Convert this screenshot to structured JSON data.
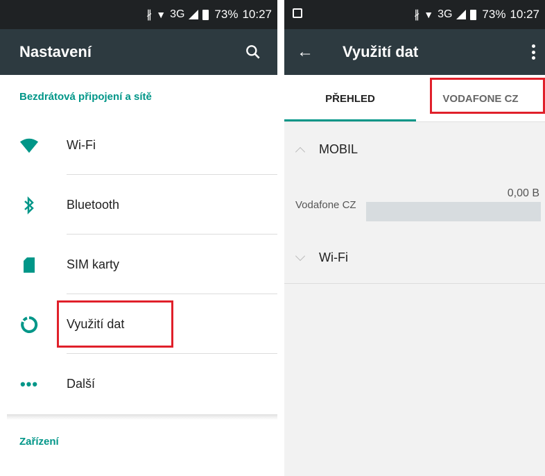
{
  "left_screen": {
    "status": {
      "network": "3G",
      "battery": "73%",
      "time": "10:27"
    },
    "toolbar": {
      "title": "Nastavení"
    },
    "section_wireless": "Bezdrátová připojení a sítě",
    "items": [
      {
        "label": "Wi-Fi",
        "icon": "wifi-icon"
      },
      {
        "label": "Bluetooth",
        "icon": "bluetooth-icon"
      },
      {
        "label": "SIM karty",
        "icon": "sim-card-icon"
      },
      {
        "label": "Využití dat",
        "icon": "data-usage-icon"
      },
      {
        "label": "Další",
        "icon": "more-horiz-icon"
      }
    ],
    "section_device": "Zařízení"
  },
  "right_screen": {
    "status": {
      "network": "3G",
      "battery": "73%",
      "time": "10:27"
    },
    "toolbar": {
      "title": "Využití dat"
    },
    "tabs": [
      {
        "label": "PŘEHLED",
        "active": true
      },
      {
        "label": "VODAFONE CZ",
        "active": false
      }
    ],
    "mobile_section": {
      "label": "MOBIL",
      "expanded": true
    },
    "usage_row": {
      "label": "Vodafone CZ",
      "value": "0,00 B"
    },
    "wifi_section": {
      "label": "Wi-Fi",
      "expanded": false
    }
  },
  "colors": {
    "accent": "#009688",
    "toolbar": "#2d3a40",
    "statusbar": "#1f2224",
    "highlight": "#e0202a"
  }
}
